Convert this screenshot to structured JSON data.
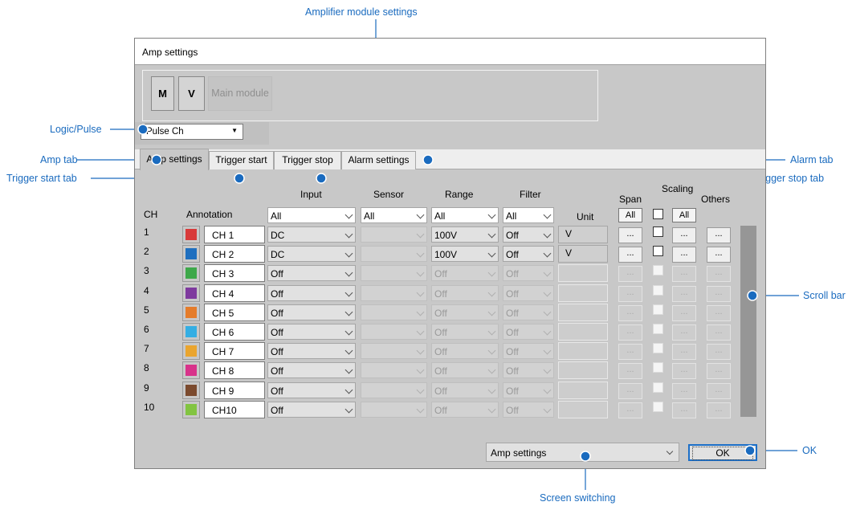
{
  "annotations": {
    "amplifier_module_settings": "Amplifier module settings",
    "logic_pulse": "Logic/Pulse",
    "amp_tab": "Amp tab",
    "trigger_start_tab": "Trigger start tab",
    "alarm_tab": "Alarm tab",
    "trigger_stop_tab": "Trigger stop tab",
    "scroll_bar": "Scroll bar",
    "ok": "OK",
    "screen_switching": "Screen switching"
  },
  "window": {
    "title": "Amp settings"
  },
  "modules": {
    "m": "M",
    "v": "V",
    "main": "Main module"
  },
  "logic_select": {
    "value": "Pulse Ch"
  },
  "tabs": [
    "Amp settings",
    "Trigger start",
    "Trigger stop",
    "Alarm settings"
  ],
  "headers": {
    "ch": "CH",
    "annotation": "Annotation",
    "input": "Input",
    "sensor": "Sensor",
    "range": "Range",
    "filter": "Filter",
    "unit": "Unit",
    "scaling": "Scaling",
    "span": "Span",
    "others": "Others"
  },
  "all_row": {
    "input": "All",
    "sensor": "All",
    "range": "All",
    "filter": "All",
    "span_btn": "All",
    "scaling_btn": "All"
  },
  "dots_label": "...",
  "channels": [
    {
      "num": "1",
      "name": "CH 1",
      "color": "#d83a3a",
      "input": "DC",
      "range": "100V",
      "filter": "Off",
      "unit": "V"
    },
    {
      "num": "2",
      "name": "CH 2",
      "color": "#1f6fbf",
      "input": "DC",
      "range": "100V",
      "filter": "Off",
      "unit": "V"
    },
    {
      "num": "3",
      "name": "CH 3",
      "color": "#3ea84a",
      "input": "Off",
      "range": "Off",
      "filter": "Off",
      "unit": ""
    },
    {
      "num": "4",
      "name": "CH 4",
      "color": "#7e3a9e",
      "input": "Off",
      "range": "Off",
      "filter": "Off",
      "unit": ""
    },
    {
      "num": "5",
      "name": "CH 5",
      "color": "#e57c2a",
      "input": "Off",
      "range": "Off",
      "filter": "Off",
      "unit": ""
    },
    {
      "num": "6",
      "name": "CH 6",
      "color": "#35aee3",
      "input": "Off",
      "range": "Off",
      "filter": "Off",
      "unit": ""
    },
    {
      "num": "7",
      "name": "CH 7",
      "color": "#eaa52e",
      "input": "Off",
      "range": "Off",
      "filter": "Off",
      "unit": ""
    },
    {
      "num": "8",
      "name": "CH 8",
      "color": "#d8328a",
      "input": "Off",
      "range": "Off",
      "filter": "Off",
      "unit": ""
    },
    {
      "num": "9",
      "name": "CH 9",
      "color": "#7b4a2e",
      "input": "Off",
      "range": "Off",
      "filter": "Off",
      "unit": ""
    },
    {
      "num": "10",
      "name": "CH10",
      "color": "#82c441",
      "input": "Off",
      "range": "Off",
      "filter": "Off",
      "unit": ""
    }
  ],
  "screen_select": {
    "value": "Amp settings"
  },
  "ok_button": {
    "label": "OK"
  },
  "colors": {
    "accent": "#1a6bbf",
    "window_bg": "#c8c8c8"
  }
}
